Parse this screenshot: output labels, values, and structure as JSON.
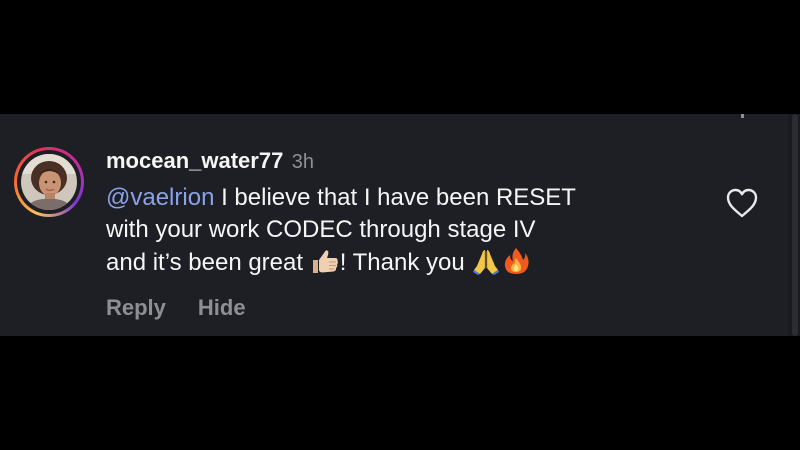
{
  "comment": {
    "username": "mocean_water77",
    "timestamp": "3h",
    "mention": "@vaelrion",
    "text_line1": " I believe that I have been RESET",
    "text_line2": "with your work CODEC through stage IV",
    "text_line3_a": "and it’s been great ",
    "text_line3_b": "! Thank you ",
    "emojis": [
      "thumbs-up-icon",
      "folded-hands-icon",
      "fire-icon"
    ]
  },
  "actions": {
    "reply_label": "Reply",
    "hide_label": "Hide"
  },
  "icons": {
    "like": "heart-outline-icon",
    "avatar": "user-avatar-photo"
  },
  "colors": {
    "panel_background": "#1e1f24",
    "outer_background": "#000000",
    "text": "#f5f5f5",
    "muted": "#8e8f94",
    "mention": "#8aa2e6"
  }
}
